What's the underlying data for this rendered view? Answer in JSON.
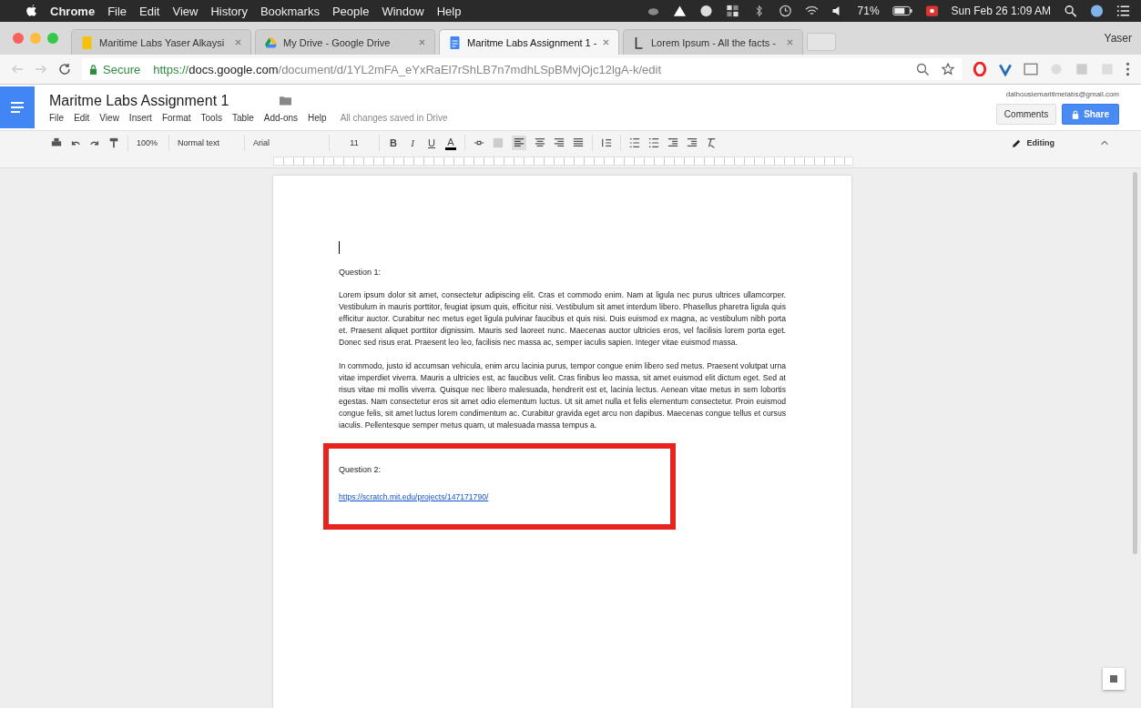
{
  "menu_bar": {
    "app": "Chrome",
    "items": [
      "File",
      "Edit",
      "View",
      "History",
      "Bookmarks",
      "People",
      "Window",
      "Help"
    ],
    "battery": "71%",
    "clock": "Sun Feb 26  1:09 AM"
  },
  "tabs": [
    {
      "title": "Maritime Labs Yaser Alkaysi",
      "kind": "yellow-doc",
      "selected": false
    },
    {
      "title": "My Drive - Google Drive",
      "kind": "drive",
      "selected": false
    },
    {
      "title": "Maritme Labs Assignment 1 -",
      "kind": "blue-doc",
      "selected": true
    },
    {
      "title": "Lorem Ipsum - All the facts -",
      "kind": "text",
      "selected": false
    }
  ],
  "profile": "Yaser",
  "address_bar": {
    "secure_label": "Secure",
    "scheme": "https://",
    "host": "docs.google.com",
    "path": "/document/d/1YL2mFA_eYxRaEl7rShLB7n7mdhLSpBMvjOjc12lgA-k/edit"
  },
  "document": {
    "title": "Maritme Labs Assignment 1",
    "menus": [
      "File",
      "Edit",
      "View",
      "Insert",
      "Format",
      "Tools",
      "Table",
      "Add-ons",
      "Help"
    ],
    "save_status": "All changes saved in Drive",
    "account": "dalhousiemaritimelabs@gmail.com",
    "comments_button": "Comments",
    "share_button": "Share"
  },
  "toolbar": {
    "zoom": "100%",
    "style": "Normal text",
    "font": "Arial",
    "size": "11",
    "format_buttons": [
      "B",
      "I",
      "U",
      "A"
    ],
    "mode": "Editing"
  },
  "page": {
    "question_1": "Question 1:",
    "paragraphs": [
      "Lorem ipsum dolor sit amet, consectetur adipiscing elit. Cras et commodo enim. Nam at ligula nec purus ultrices ullamcorper. Vestibulum in mauris porttitor, feugiat ipsum quis, efficitur nisi. Vestibulum sit amet interdum libero. Phasellus pharetra ligula quis efficitur auctor. Curabitur nec metus eget ligula pulvinar faucibus et quis nisi. Duis euismod ex magna, ac vestibulum nibh porta et. Praesent aliquet porttitor dignissim. Mauris sed laoreet nunc. Maecenas auctor ultricies eros, vel facilisis lorem porta eget. Donec sed risus erat. Praesent leo leo, facilisis nec massa ac, semper iaculis sapien. Integer vitae euismod massa.",
      "In commodo, justo id accumsan vehicula, enim arcu lacinia purus, tempor congue enim libero sed metus. Praesent volutpat urna vitae imperdiet viverra. Mauris a ultricies est, ac faucibus velit. Cras finibus leo massa, sit amet euismod elit dictum eget. Sed at risus vitae mi mollis viverra. Quisque nec libero malesuada, hendrerit est et, lacinia lectus. Aenean vitae metus in sem lobortis egestas. Nam consectetur eros sit amet odio elementum luctus. Ut sit amet nulla et felis elementum consectetur. Proin euismod congue felis, sit amet luctus lorem condimentum ac. Curabitur gravida eget arcu non dapibus. Maecenas congue tellus et cursus iaculis. Pellentesque semper metus quam, ut malesuada massa tempus a."
    ],
    "highlighted_section": {
      "question_2": "Question 2:",
      "link": "https://scratch.mit.edu/projects/147171790/"
    }
  }
}
